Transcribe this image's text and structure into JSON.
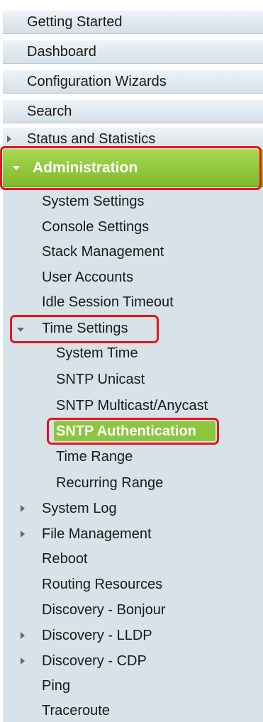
{
  "sidebar": {
    "top_items": [
      {
        "label": "Getting Started"
      },
      {
        "label": "Dashboard"
      },
      {
        "label": "Configuration Wizards"
      },
      {
        "label": "Search"
      },
      {
        "label": "Status and Statistics",
        "expandable": true,
        "expanded": false
      }
    ],
    "active_section": {
      "label": "Administration",
      "expanded": true
    },
    "admin_items": [
      {
        "label": "System Settings"
      },
      {
        "label": "Console Settings"
      },
      {
        "label": "Stack Management"
      },
      {
        "label": "User Accounts"
      },
      {
        "label": "Idle Session Timeout"
      },
      {
        "label": "Time Settings",
        "expandable": true,
        "expanded": true
      },
      {
        "label": "System Time"
      },
      {
        "label": "SNTP Unicast"
      },
      {
        "label": "SNTP Multicast/Anycast"
      },
      {
        "label": "SNTP Authentication",
        "selected": true
      },
      {
        "label": "Time Range"
      },
      {
        "label": "Recurring Range"
      },
      {
        "label": "System Log",
        "expandable": true,
        "expanded": false
      },
      {
        "label": "File Management",
        "expandable": true,
        "expanded": false
      },
      {
        "label": "Reboot"
      },
      {
        "label": "Routing Resources"
      },
      {
        "label": "Discovery - Bonjour"
      },
      {
        "label": "Discovery - LLDP",
        "expandable": true,
        "expanded": false
      },
      {
        "label": "Discovery - CDP",
        "expandable": true,
        "expanded": false
      },
      {
        "label": "Ping"
      },
      {
        "label": "Traceroute"
      }
    ]
  },
  "colors": {
    "active_green": "#8cc63f",
    "highlight_red": "#e8141a",
    "menu_bg": "#d8e2e9"
  }
}
